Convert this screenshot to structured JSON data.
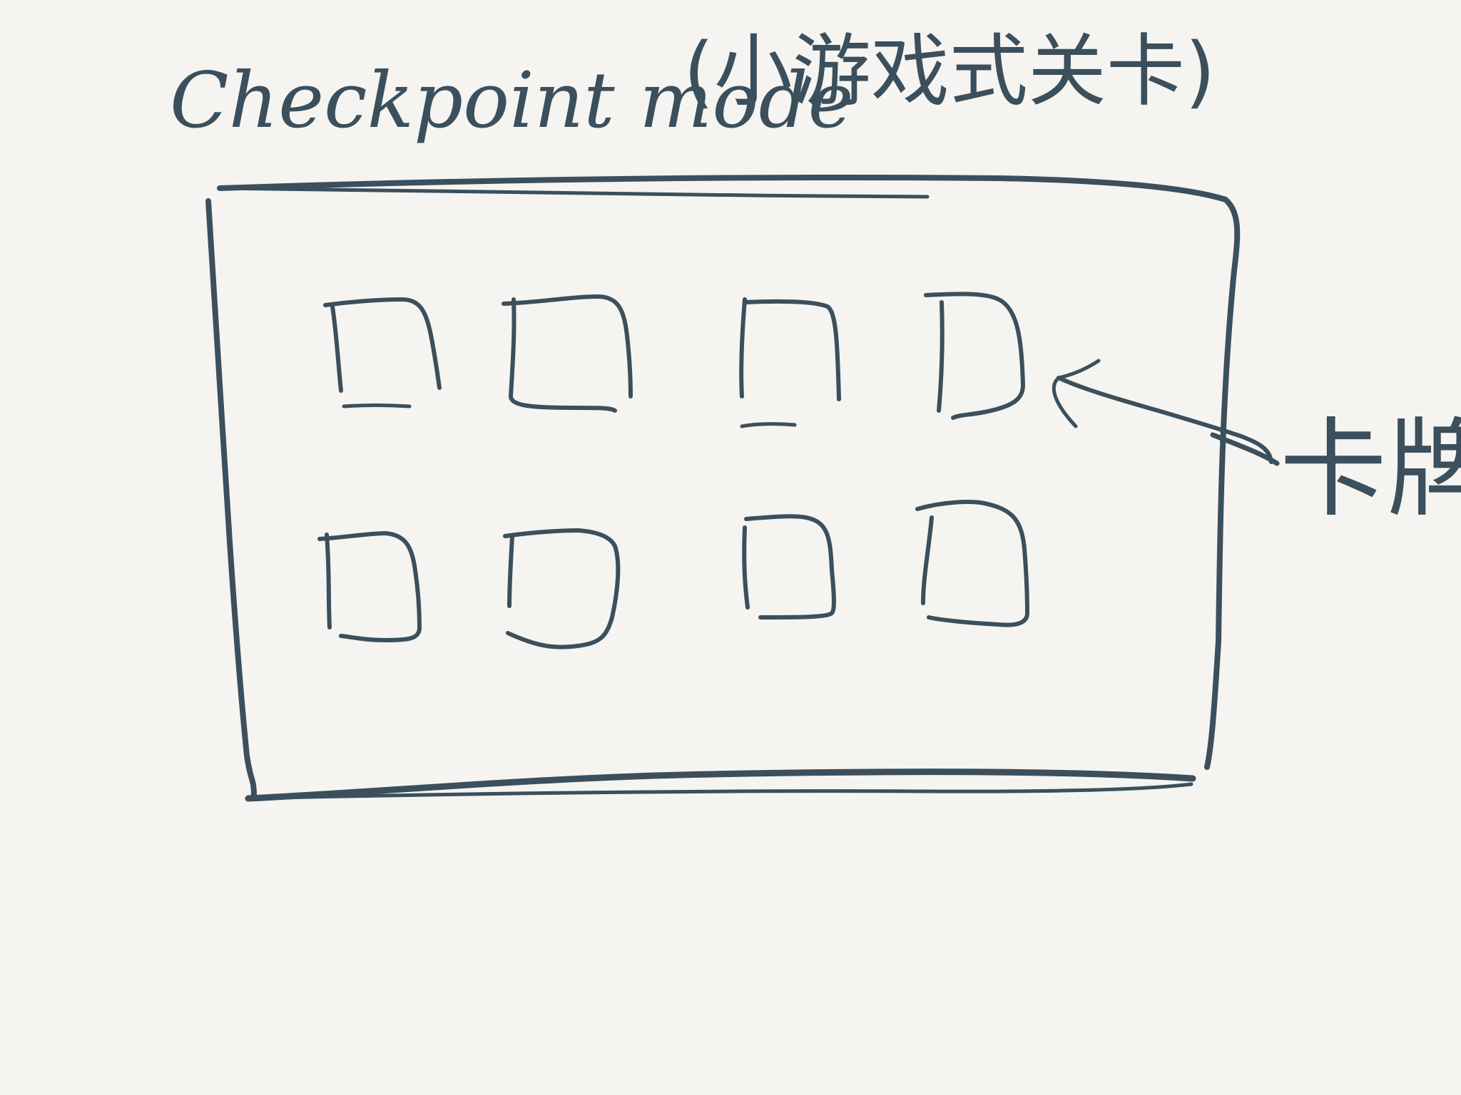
{
  "title": {
    "english": "Checkpoint mode",
    "chinese": "(小游戏式关卡)"
  },
  "annotation": {
    "label": "卡牌"
  },
  "colors": {
    "background": "#f5f4f1",
    "ink": "#3b4f5c"
  },
  "grid": {
    "rows": 2,
    "columns": 4
  }
}
